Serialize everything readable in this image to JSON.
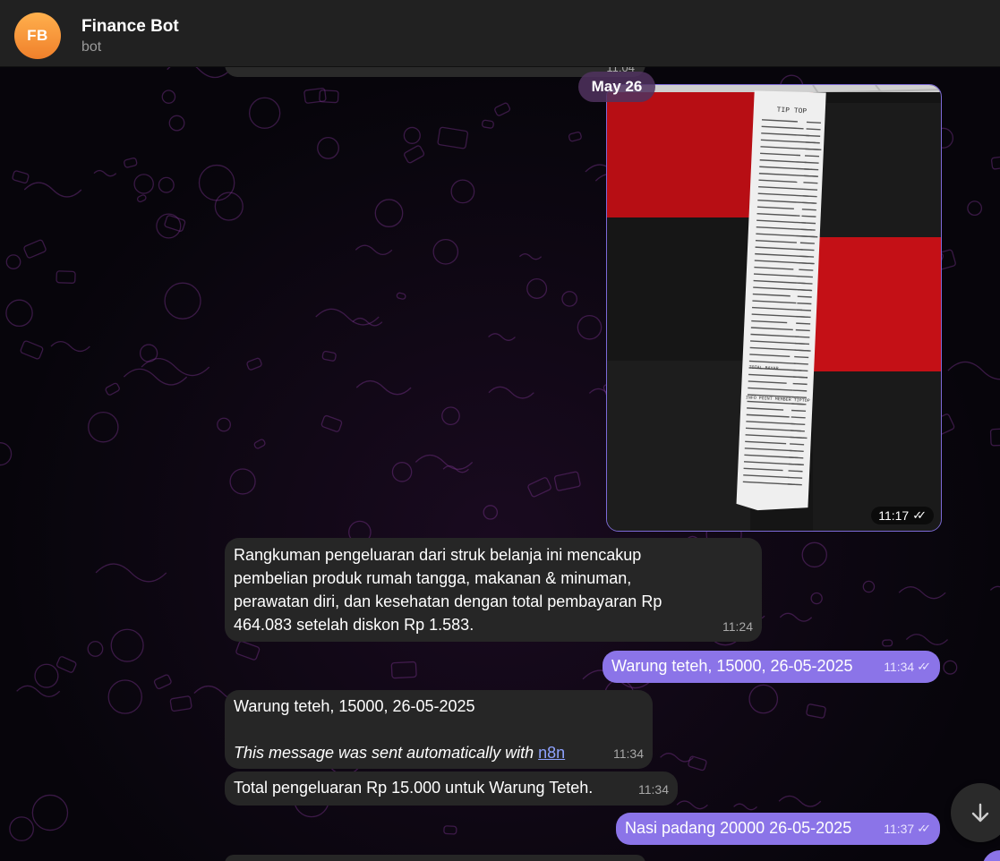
{
  "header": {
    "avatar_initials": "FB",
    "title": "Finance Bot",
    "subtitle": "bot"
  },
  "date_separator": "May 26",
  "messages": [
    {
      "id": "cut-top",
      "direction": "in",
      "time": "11:04"
    },
    {
      "id": "receipt-photo",
      "direction": "out",
      "type": "photo",
      "photo_text": {
        "store": "TIP TOP",
        "total_label": "TOTAL BAYAR",
        "member_label": "INFO POINT MEMBER TIPTOP"
      },
      "time": "11:17"
    },
    {
      "id": "summary",
      "direction": "in",
      "lines": [
        "Rangkuman pengeluaran dari struk belanja ini mencakup",
        "pembelian produk rumah tangga, makanan & minuman,",
        "perawatan diri, dan kesehatan dengan total pembayaran Rp",
        "464.083 setelah diskon Rp 1.583."
      ],
      "time": "11:24"
    },
    {
      "id": "warung-out",
      "direction": "out",
      "text": "Warung teteh, 15000, 26-05-2025",
      "time": "11:34"
    },
    {
      "id": "warung-echo",
      "direction": "in",
      "text": "Warung teteh, 15000, 26-05-2025",
      "auto_text": "This message was sent automatically with ",
      "link_text": "n8n",
      "time": "11:34"
    },
    {
      "id": "warung-total",
      "direction": "in",
      "text": "Total pengeluaran Rp 15.000 untuk Warung Teteh.",
      "time": "11:34"
    },
    {
      "id": "nasi-out",
      "direction": "out",
      "text": "Nasi padang 20000 26-05-2025",
      "time": "11:37"
    }
  ],
  "colors": {
    "header_bg": "#212121",
    "incoming_bubble": "#262626",
    "outgoing_bubble": "#8b74e8",
    "avatar": "#f5933a",
    "link": "#8fa3ff"
  },
  "icons": {
    "read_receipt": "double-check-icon",
    "scroll_down": "arrow-down-icon"
  }
}
